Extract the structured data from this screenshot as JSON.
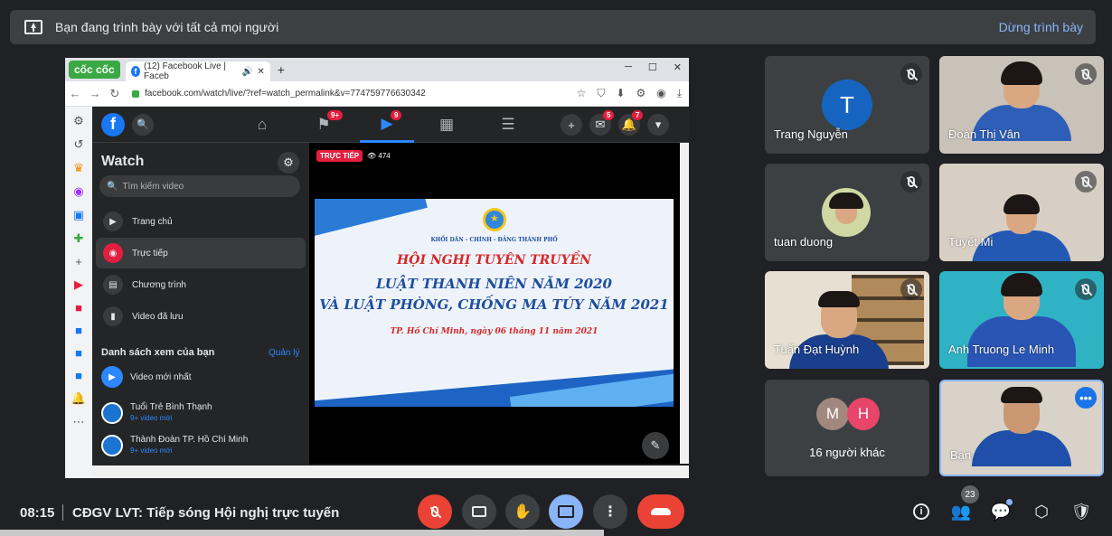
{
  "presenting_bar": {
    "message": "Bạn đang trình bày với tất cả mọi người",
    "stop_label": "Dừng trình bày"
  },
  "browser": {
    "brand": "cốc cốc",
    "tab_title": "(12) Facebook Live | Faceb",
    "url": "facebook.com/watch/live/?ref=watch_permalink&v=774759776630342",
    "facebook": {
      "badges": {
        "pages": "9+",
        "watch": "9",
        "messenger": "5",
        "notifications": "7"
      },
      "watch_title": "Watch",
      "search_placeholder": "Tìm kiếm video",
      "menu": [
        {
          "label": "Trang chủ"
        },
        {
          "label": "Trực tiếp"
        },
        {
          "label": "Chương trình"
        },
        {
          "label": "Video đã lưu"
        }
      ],
      "watchlist_title": "Danh sách xem của bạn",
      "manage_label": "Quản lý",
      "latest_label": "Video mới nhất",
      "subscriptions": [
        {
          "name": "Tuổi Trẻ Bình Thạnh",
          "meta": "9+ video mới"
        },
        {
          "name": "Thành Đoàn TP. Hồ Chí Minh",
          "meta": "9+ video mới"
        }
      ],
      "video": {
        "live_label": "TRỰC TIẾP",
        "viewers": "474",
        "banner_org": "KHỐI DÂN - CHÍNH - ĐẢNG THÀNH PHỐ",
        "banner_line1": "HỘI NGHỊ TUYÊN TRUYỀN",
        "banner_line2": "LUẬT THANH NIÊN NĂM 2020",
        "banner_line3": "VÀ LUẬT PHÒNG, CHỐNG MA TÚY NĂM 2021",
        "banner_date": "TP. Hồ Chí Minh, ngày 06 tháng 11 năm 2021"
      }
    }
  },
  "participants": [
    {
      "name": "Trang Nguyễn",
      "initial": "T",
      "avatar_color": "#1565c0"
    },
    {
      "name": "Đoàn Thị Vân"
    },
    {
      "name": "tuan duong"
    },
    {
      "name": "Tuyết Mi"
    },
    {
      "name": "Tuấn Đạt Huỳnh"
    },
    {
      "name": "Anh Truong Le Minh"
    },
    {
      "others_label": "16 người khác",
      "initials": [
        "M",
        "H"
      ],
      "colors": [
        "#a1887f",
        "#e8456b"
      ]
    },
    {
      "name": "Bạn"
    }
  ],
  "bottom": {
    "time": "08:15",
    "meeting_title": "CĐGV LVT: Tiếp sóng Hội nghị trực tuyến",
    "participant_count": "23"
  },
  "colors": {
    "end_call": "#ea4335",
    "present_active": "#8ab4f8",
    "mic_off": "#ea4335"
  }
}
